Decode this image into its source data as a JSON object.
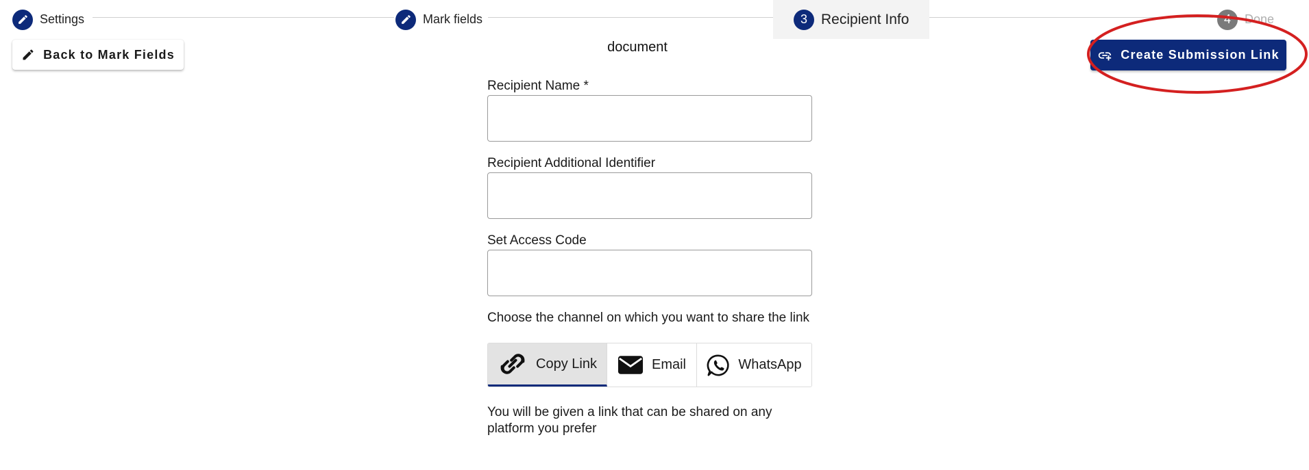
{
  "stepper": {
    "steps": [
      {
        "label": "Settings",
        "icon": "pencil-icon",
        "state": "complete"
      },
      {
        "label": "Mark fields",
        "icon": "pencil-icon",
        "state": "complete"
      },
      {
        "number": "3",
        "label": "Recipient Info",
        "state": "active"
      },
      {
        "number": "4",
        "label": "Done",
        "state": "inactive"
      }
    ]
  },
  "toolbar": {
    "back_label": "Back to Mark Fields",
    "create_label": "Create Submission Link"
  },
  "document": {
    "title": "document"
  },
  "form": {
    "recipient_name_label": "Recipient Name *",
    "recipient_name_value": "",
    "additional_id_label": "Recipient Additional Identifier",
    "additional_id_value": "",
    "access_code_label": "Set Access Code",
    "access_code_value": ""
  },
  "channels": {
    "prompt": "Choose the channel on which you want to share the link",
    "options": [
      {
        "label": "Copy Link",
        "icon": "link-icon",
        "selected": true
      },
      {
        "label": "Email",
        "icon": "envelope-icon",
        "selected": false
      },
      {
        "label": "WhatsApp",
        "icon": "whatsapp-icon",
        "selected": false
      }
    ],
    "info": "You will be given a link that can be shared on any platform you prefer"
  },
  "colors": {
    "primary": "#0d2a7a",
    "annotation": "#d42020",
    "inactive_step": "#7a7a7a"
  }
}
